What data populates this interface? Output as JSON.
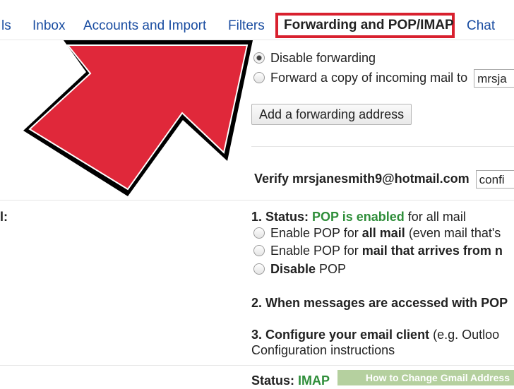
{
  "tabs": {
    "labels_partial": "ls",
    "inbox": "Inbox",
    "accounts": "Accounts and Import",
    "filters": "Filters",
    "forwarding": "Forwarding and POP/IMAP",
    "chat": "Chat"
  },
  "forwarding": {
    "disable_label": "Disable forwarding",
    "forward_copy_label": "Forward a copy of incoming mail to",
    "forward_address_value": "mrsja",
    "add_button": "Add a forwarding address",
    "verify_label": "Verify mrsjanesmith9@hotmail.com",
    "verify_input_value": "confi"
  },
  "pop": {
    "section_label_partial": "l:",
    "status_prefix": "1. Status:",
    "status_value": "POP is enabled",
    "status_suffix": "for all mail",
    "opt1_prefix": "Enable POP for",
    "opt1_bold": "all mail",
    "opt1_suffix": "(even mail that's",
    "opt2_prefix": "Enable POP for",
    "opt2_bold": "mail that arrives from n",
    "opt3_bold": "Disable",
    "opt3_suffix": "POP",
    "step2": "2. When messages are accessed with POP",
    "step3_bold": "3. Configure your email client",
    "step3_suffix": "(e.g. Outloo",
    "config_link": "Configuration instructions"
  },
  "imap": {
    "status_prefix": "Status:",
    "status_value": "IMAP"
  },
  "watermark": {
    "text": "How to Change Gmail Address"
  },
  "colors": {
    "link": "#1a4da1",
    "highlight_border": "#d8202e",
    "arrow_fill": "#e0283a",
    "status_green": "#2f8e3a"
  }
}
